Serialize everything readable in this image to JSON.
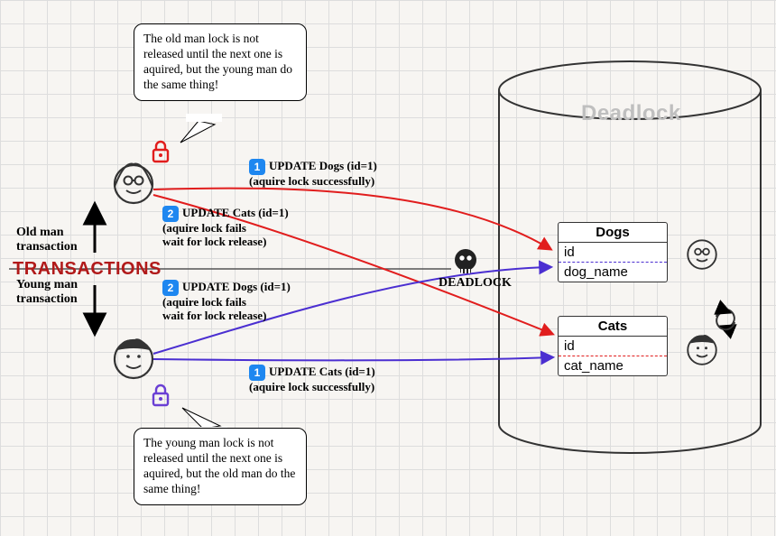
{
  "title": "Deadlock",
  "transactions_label": "TRANSACTIONS",
  "old_man_label": "Old man\ntransaction",
  "young_man_label": "Young man\ntransaction",
  "deadlock_label": "DEADLOCK",
  "speech_top": "The old man lock is not released until the next one is aquired, but the young man do the same thing!",
  "speech_bottom": "The young man lock is not released until the next one is aquired, but the old man do the same thing!",
  "old": {
    "step1": {
      "badge": "1",
      "text": "UPDATE Dogs (id=1)\n(aquire lock successfully)"
    },
    "step2": {
      "badge": "2",
      "text": "UPDATE Cats (id=1)\n(aquire lock fails\nwait for lock release)"
    }
  },
  "young": {
    "step1": {
      "badge": "1",
      "text": "UPDATE Cats (id=1)\n(aquire lock successfully)"
    },
    "step2": {
      "badge": "2",
      "text": "UPDATE Dogs (id=1)\n(aquire lock fails\nwait for lock release)"
    }
  },
  "tables": {
    "dogs": {
      "name": "Dogs",
      "cols": [
        "id",
        "dog_name"
      ]
    },
    "cats": {
      "name": "Cats",
      "cols": [
        "id",
        "cat_name"
      ]
    }
  },
  "colors": {
    "old": "#e11d1d",
    "young": "#4b2fd1",
    "purple_lock": "#6a3fd4"
  }
}
